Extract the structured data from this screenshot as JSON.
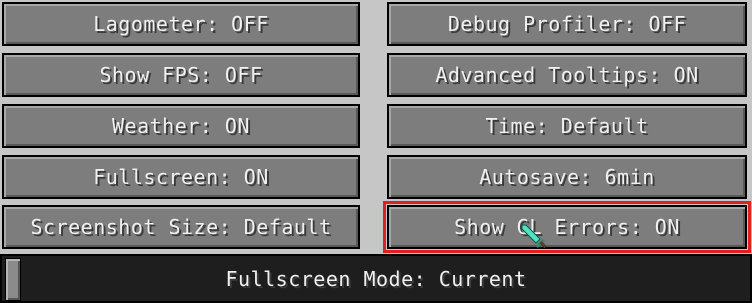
{
  "settings": {
    "left": [
      "Lagometer: OFF",
      "Show FPS: OFF",
      "Weather: ON",
      "Fullscreen: ON",
      "Screenshot Size: Default"
    ],
    "right": [
      "Debug Profiler: OFF",
      "Advanced Tooltips: ON",
      "Time: Default",
      "Autosave: 6min",
      "Show GL Errors: ON"
    ]
  },
  "slider": {
    "label": "Fullscreen Mode: Current",
    "position": 0.0
  },
  "colors": {
    "button_face": "#7d7d7d",
    "highlight_outline": "#e01f1f",
    "slider_track": "#1e1e1e",
    "text": "#f0f0f0"
  },
  "icons": {
    "cursor": "sword-cursor-icon"
  }
}
